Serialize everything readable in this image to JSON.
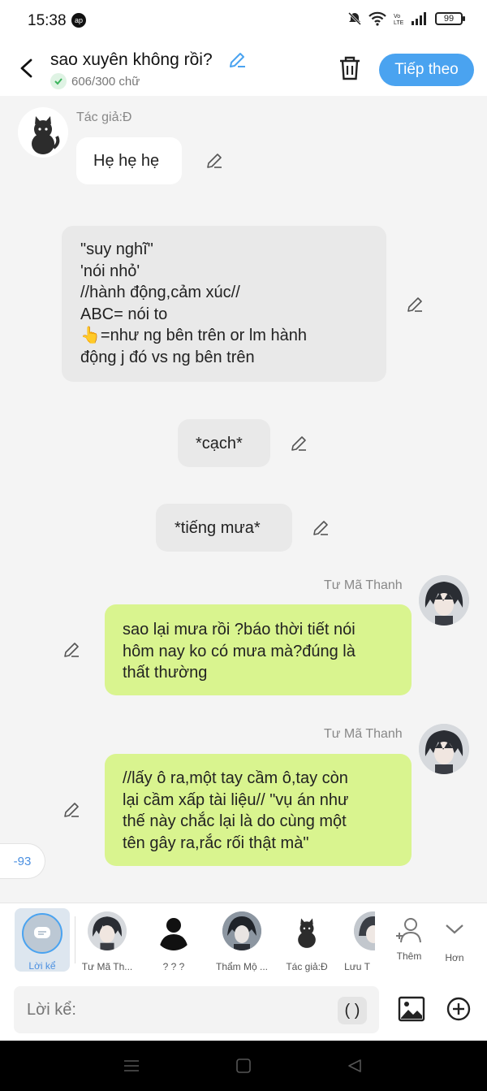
{
  "status": {
    "time": "15:38",
    "notif": "ap",
    "battery": "99"
  },
  "header": {
    "title": "sao xuyên không rồi?",
    "counter": "606/300 chữ",
    "next_label": "Tiếp theo"
  },
  "messages": [
    {
      "speaker": "Tác giả:Đ",
      "text": "Hẹ hẹ hẹ"
    },
    {
      "lines": [
        "\"suy nghĩ\"",
        "'nói nhỏ'",
        "//hành động,cảm xúc//",
        "ABC= nói to",
        "👆=như ng bên trên or lm hành",
        "động j đó vs ng bên trên"
      ]
    },
    {
      "text": "*cạch*"
    },
    {
      "text": "*tiếng mưa*"
    },
    {
      "speaker": "Tư Mã Thanh",
      "lines": [
        "sao lại mưa rồi ?báo thời tiết nói",
        "hôm nay ko có mưa mà?đúng là",
        "thất thường"
      ]
    },
    {
      "speaker": "Tư Mã Thanh",
      "lines": [
        "//lấy ô ra,một tay cầm ô,tay còn",
        "lại cầm xấp tài liệu// \"vụ án như",
        "thế này chắc lại là do cùng một",
        "tên gây ra,rắc rối thật mà\""
      ]
    }
  ],
  "badge": "-93",
  "characters": [
    {
      "label": "Lời kể"
    },
    {
      "label": "Tư Mã Th..."
    },
    {
      "label": "? ? ?"
    },
    {
      "label": "Thẩm Mộ ..."
    },
    {
      "label": "Tác giả:Đ"
    },
    {
      "label": "Lưu T"
    },
    {
      "label": "Thêm"
    },
    {
      "label": "Hơn"
    }
  ],
  "input": {
    "placeholder": "Lời kể:",
    "paren": "( )"
  },
  "colors": {
    "accent": "#4aa3f0",
    "green_bubble": "#d9f48f",
    "grey_bubble": "#e9e9e9"
  },
  "icons": [
    "back-arrow-icon",
    "pencil-icon",
    "check-icon",
    "trash-icon",
    "chat-bubble-icon",
    "add-person-icon",
    "chevron-down-icon",
    "image-icon",
    "plus-circle-icon"
  ]
}
